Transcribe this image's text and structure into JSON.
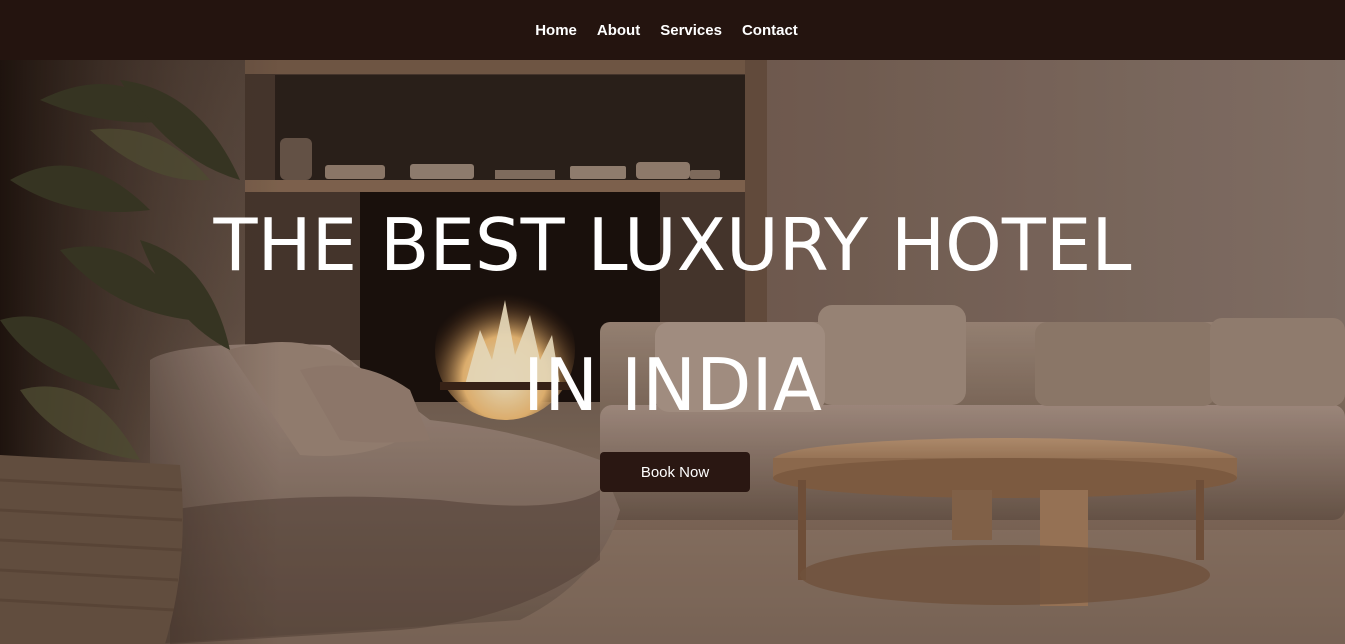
{
  "nav": {
    "links": [
      {
        "label": "Home"
      },
      {
        "label": "About"
      },
      {
        "label": "Services"
      },
      {
        "label": "Contact"
      }
    ]
  },
  "hero": {
    "title_line1": "THE BEST LUXURY HOTEL",
    "title_line2": "IN INDIA",
    "cta_label": "Book Now",
    "background_description_icon": "living-room-photo"
  },
  "colors": {
    "nav_bg": "#24140f",
    "button_bg": "#2a1712",
    "text": "#ffffff"
  }
}
